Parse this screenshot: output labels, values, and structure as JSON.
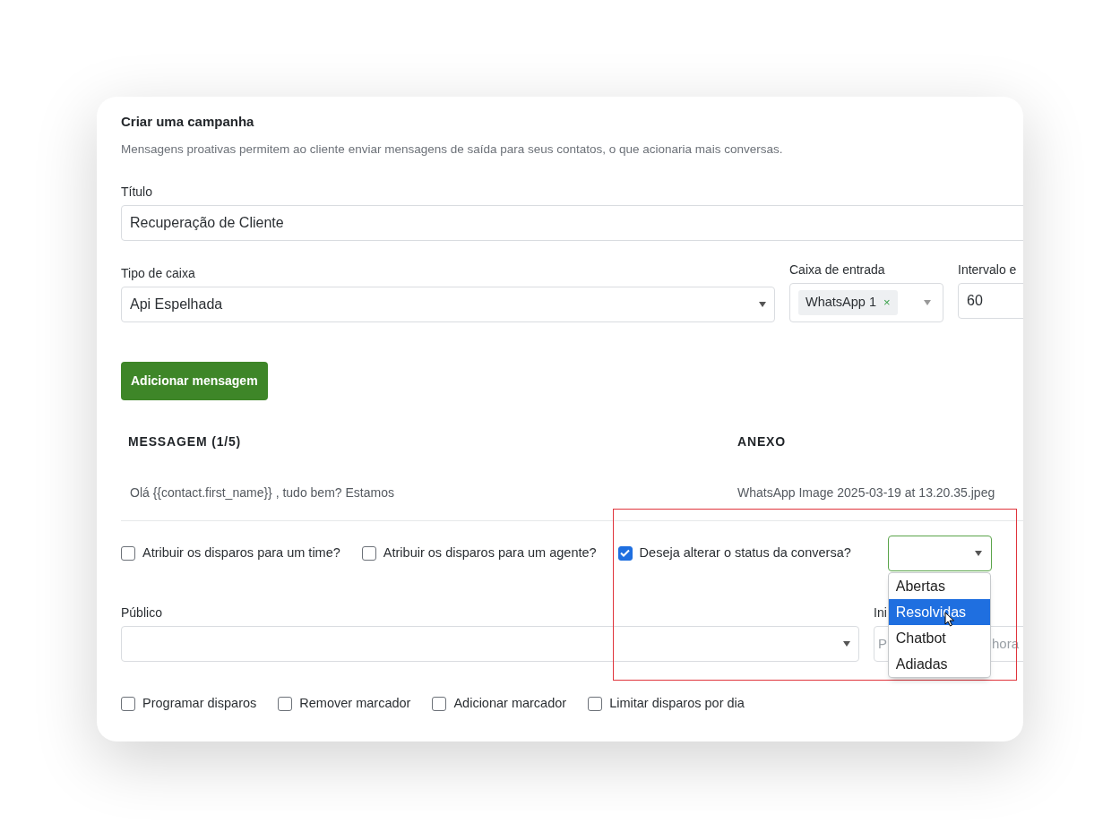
{
  "header": {
    "title": "Criar uma campanha",
    "description": "Mensagens proativas permitem ao cliente enviar mensagens de saída para seus contatos, o que acionaria mais conversas."
  },
  "title_field": {
    "label": "Título",
    "value": "Recuperação de Cliente"
  },
  "inbox_type": {
    "label": "Tipo de caixa",
    "value": "Api Espelhada"
  },
  "inbox": {
    "label": "Caixa de entrada",
    "tags": [
      {
        "label": "WhatsApp 1",
        "remove": "×"
      }
    ]
  },
  "interval": {
    "label": "Intervalo e",
    "value": "60"
  },
  "add_button": {
    "label": "Adicionar mensagem"
  },
  "messages": {
    "columns": [
      "MESSAGEM (1/5)",
      "ANEXO"
    ],
    "rows": [
      [
        "Olá {{contact.first_name}} , tudo bem? Estamos",
        "WhatsApp Image 2025-03-19 at 13.20.35.jpeg"
      ]
    ]
  },
  "options": [
    {
      "label": "Atribuir os disparos para um time?",
      "checked": false
    },
    {
      "label": "Atribuir os disparos para um agente?",
      "checked": false
    },
    {
      "label": "Deseja alterar o status da conversa?",
      "checked": true
    }
  ],
  "status_select": {
    "expanded": true,
    "options": [
      {
        "label": "Abertas",
        "selected": false
      },
      {
        "label": "Resolvidas",
        "selected": true
      },
      {
        "label": "Chatbot",
        "selected": false
      },
      {
        "label": "Adiadas",
        "selected": false
      }
    ]
  },
  "audience": {
    "label": "Público"
  },
  "start": {
    "label": "Ini",
    "placeholder_parts": [
      "P",
      "hora"
    ]
  },
  "schedule_options": [
    {
      "label": "Programar disparos",
      "checked": false
    },
    {
      "label": "Remover marcador",
      "checked": false
    },
    {
      "label": "Adicionar marcador",
      "checked": false
    },
    {
      "label": "Limitar disparos por dia",
      "checked": false
    }
  ],
  "highlight_box": true
}
